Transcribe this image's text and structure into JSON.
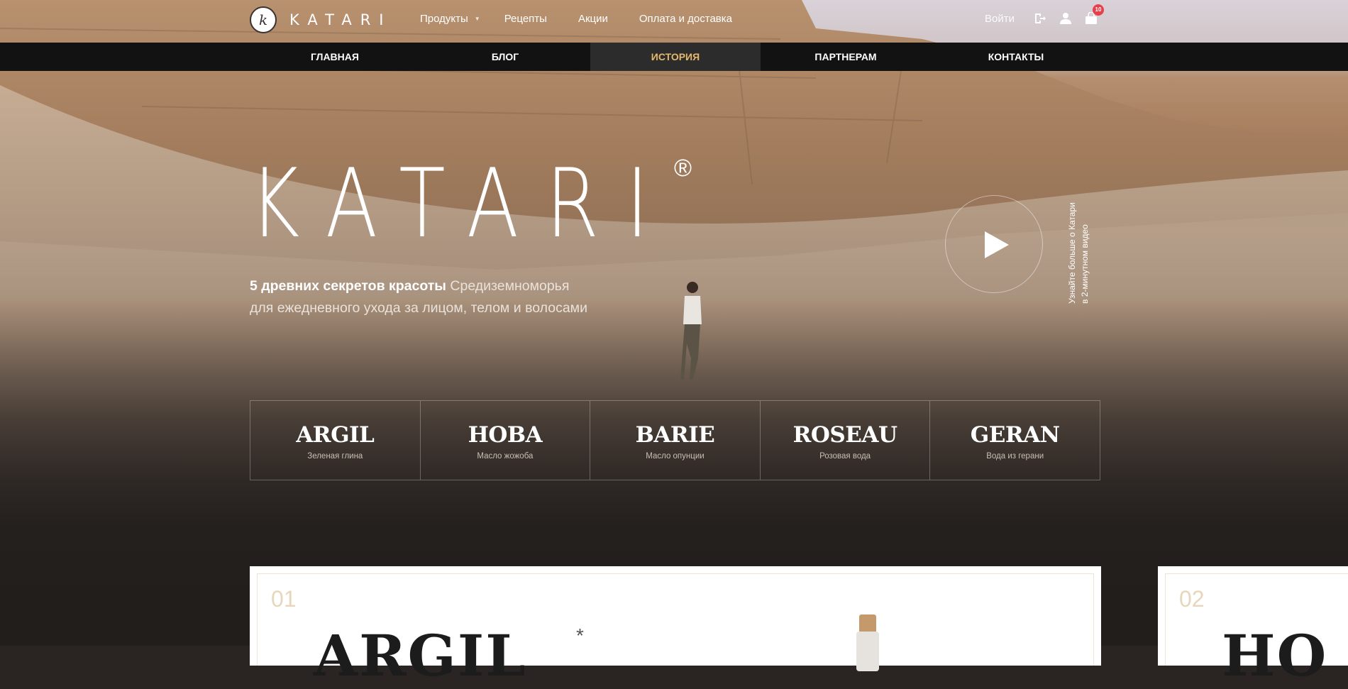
{
  "brand": {
    "logo_text": "KATARI",
    "logo_letter": "k"
  },
  "top_nav": {
    "items": [
      "Продукты",
      "Рецепты",
      "Акции",
      "Оплата и доставка"
    ],
    "login": "Войти",
    "cart_count": "10"
  },
  "sub_nav": {
    "tabs": [
      "ГЛАВНАЯ",
      "БЛОГ",
      "ИСТОРИЯ",
      "ПАРТНЕРАМ",
      "КОНТАКТЫ"
    ],
    "active": "ИСТОРИЯ"
  },
  "hero": {
    "title": "KATARI",
    "registered": "®",
    "subtitle_bold": "5 древних секретов красоты",
    "subtitle_rest": " Средиземноморья",
    "subtitle_line2": "для ежедневного ухода за лицом, телом и волосами",
    "video_caption_1": "Узнайте больше о Катари",
    "video_caption_2": "в 2-минутном видео"
  },
  "ingredients": [
    {
      "name": "ARGIL",
      "desc": "Зеленая глина"
    },
    {
      "name": "HOBA",
      "desc": "Масло жожоба"
    },
    {
      "name": "BARIE",
      "desc": "Масло опунции"
    },
    {
      "name": "ROSEAU",
      "desc": "Розовая вода"
    },
    {
      "name": "GERAN",
      "desc": "Вода из герани"
    }
  ],
  "cards": [
    {
      "number": "01",
      "title": "ARGIL",
      "star": "*"
    },
    {
      "number": "02",
      "title": "HO"
    }
  ],
  "colors": {
    "accent": "#e4b86a",
    "nav_bg": "#121212",
    "badge": "#e5414a",
    "card_number": "#e8d6bc"
  }
}
